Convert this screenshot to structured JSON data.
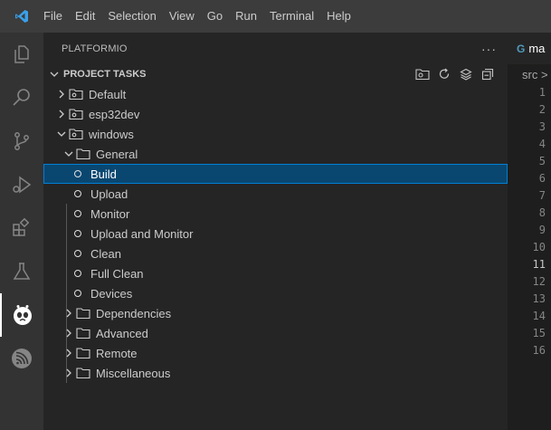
{
  "menu": [
    "File",
    "Edit",
    "Selection",
    "View",
    "Go",
    "Run",
    "Terminal",
    "Help"
  ],
  "activity_bar": [
    "explorer-icon",
    "search-icon",
    "source-control-icon",
    "run-debug-icon",
    "extensions-icon",
    "testing-icon",
    "platformio-icon",
    "espressif-icon"
  ],
  "sidebar": {
    "title": "PLATFORMIO",
    "more": "···",
    "section": "PROJECT TASKS",
    "section_actions": [
      "new-terminal-icon",
      "refresh-icon",
      "collapse-layers-icon",
      "collapse-all-icon"
    ],
    "envs": [
      "Default",
      "esp32dev",
      "windows"
    ],
    "folder_general": "General",
    "tasks": [
      "Build",
      "Upload",
      "Monitor",
      "Upload and Monitor",
      "Clean",
      "Full Clean",
      "Devices"
    ],
    "folders": [
      "Dependencies",
      "Advanced",
      "Remote",
      "Miscellaneous"
    ]
  },
  "editor": {
    "tab": "ma",
    "breadcrumb": "src >",
    "line_numbers": [
      "1",
      "2",
      "3",
      "4",
      "5",
      "6",
      "7",
      "8",
      "9",
      "10",
      "11",
      "12",
      "13",
      "14",
      "15",
      "16"
    ],
    "current_line": "11"
  },
  "colors": {
    "accent": "#007acc",
    "selection": "#094771",
    "sidebar": "#252526",
    "activity": "#333333"
  }
}
